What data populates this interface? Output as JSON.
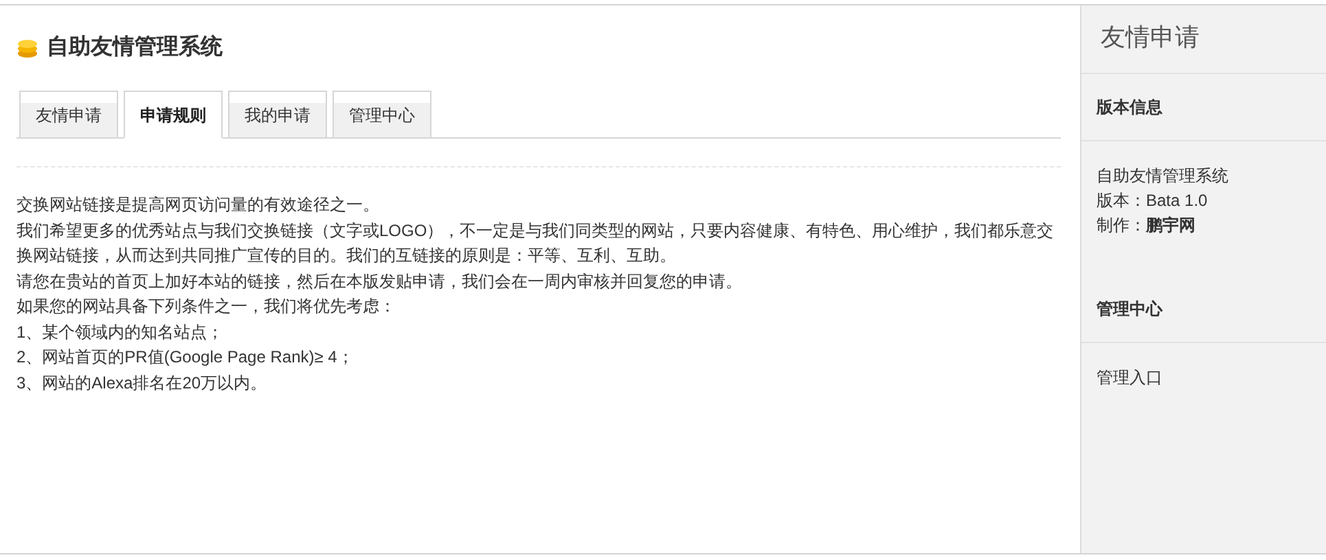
{
  "title": "自助友情管理系统",
  "tabs": [
    {
      "label": "友情申请",
      "selected": false
    },
    {
      "label": "申请规则",
      "selected": true
    },
    {
      "label": "我的申请",
      "selected": false
    },
    {
      "label": "管理中心",
      "selected": false
    }
  ],
  "content": [
    "交换网站链接是提高网页访问量的有效途径之一。",
    "我们希望更多的优秀站点与我们交换链接（文字或LOGO），不一定是与我们同类型的网站，只要内容健康、有特色、用心维护，我们都乐意交换网站链接，从而达到共同推广宣传的目的。我们的互链接的原则是：平等、互利、互助。",
    "请您在贵站的首页上加好本站的链接，然后在本版发贴申请，我们会在一周内审核并回复您的申请。",
    "如果您的网站具备下列条件之一，我们将优先考虑：",
    "1、某个领域内的知名站点；",
    "2、网站首页的PR值(Google Page Rank)≥ 4；",
    "3、网站的Alexa排名在20万以内。"
  ],
  "sidebar": {
    "title": "友情申请",
    "sections": [
      {
        "heading": "版本信息",
        "lines": [
          "自助友情管理系统",
          "版本：Bata 1.0",
          "制作：**鹏宇网**"
        ]
      },
      {
        "heading": "管理中心",
        "lines": [
          "管理入口"
        ]
      }
    ]
  }
}
